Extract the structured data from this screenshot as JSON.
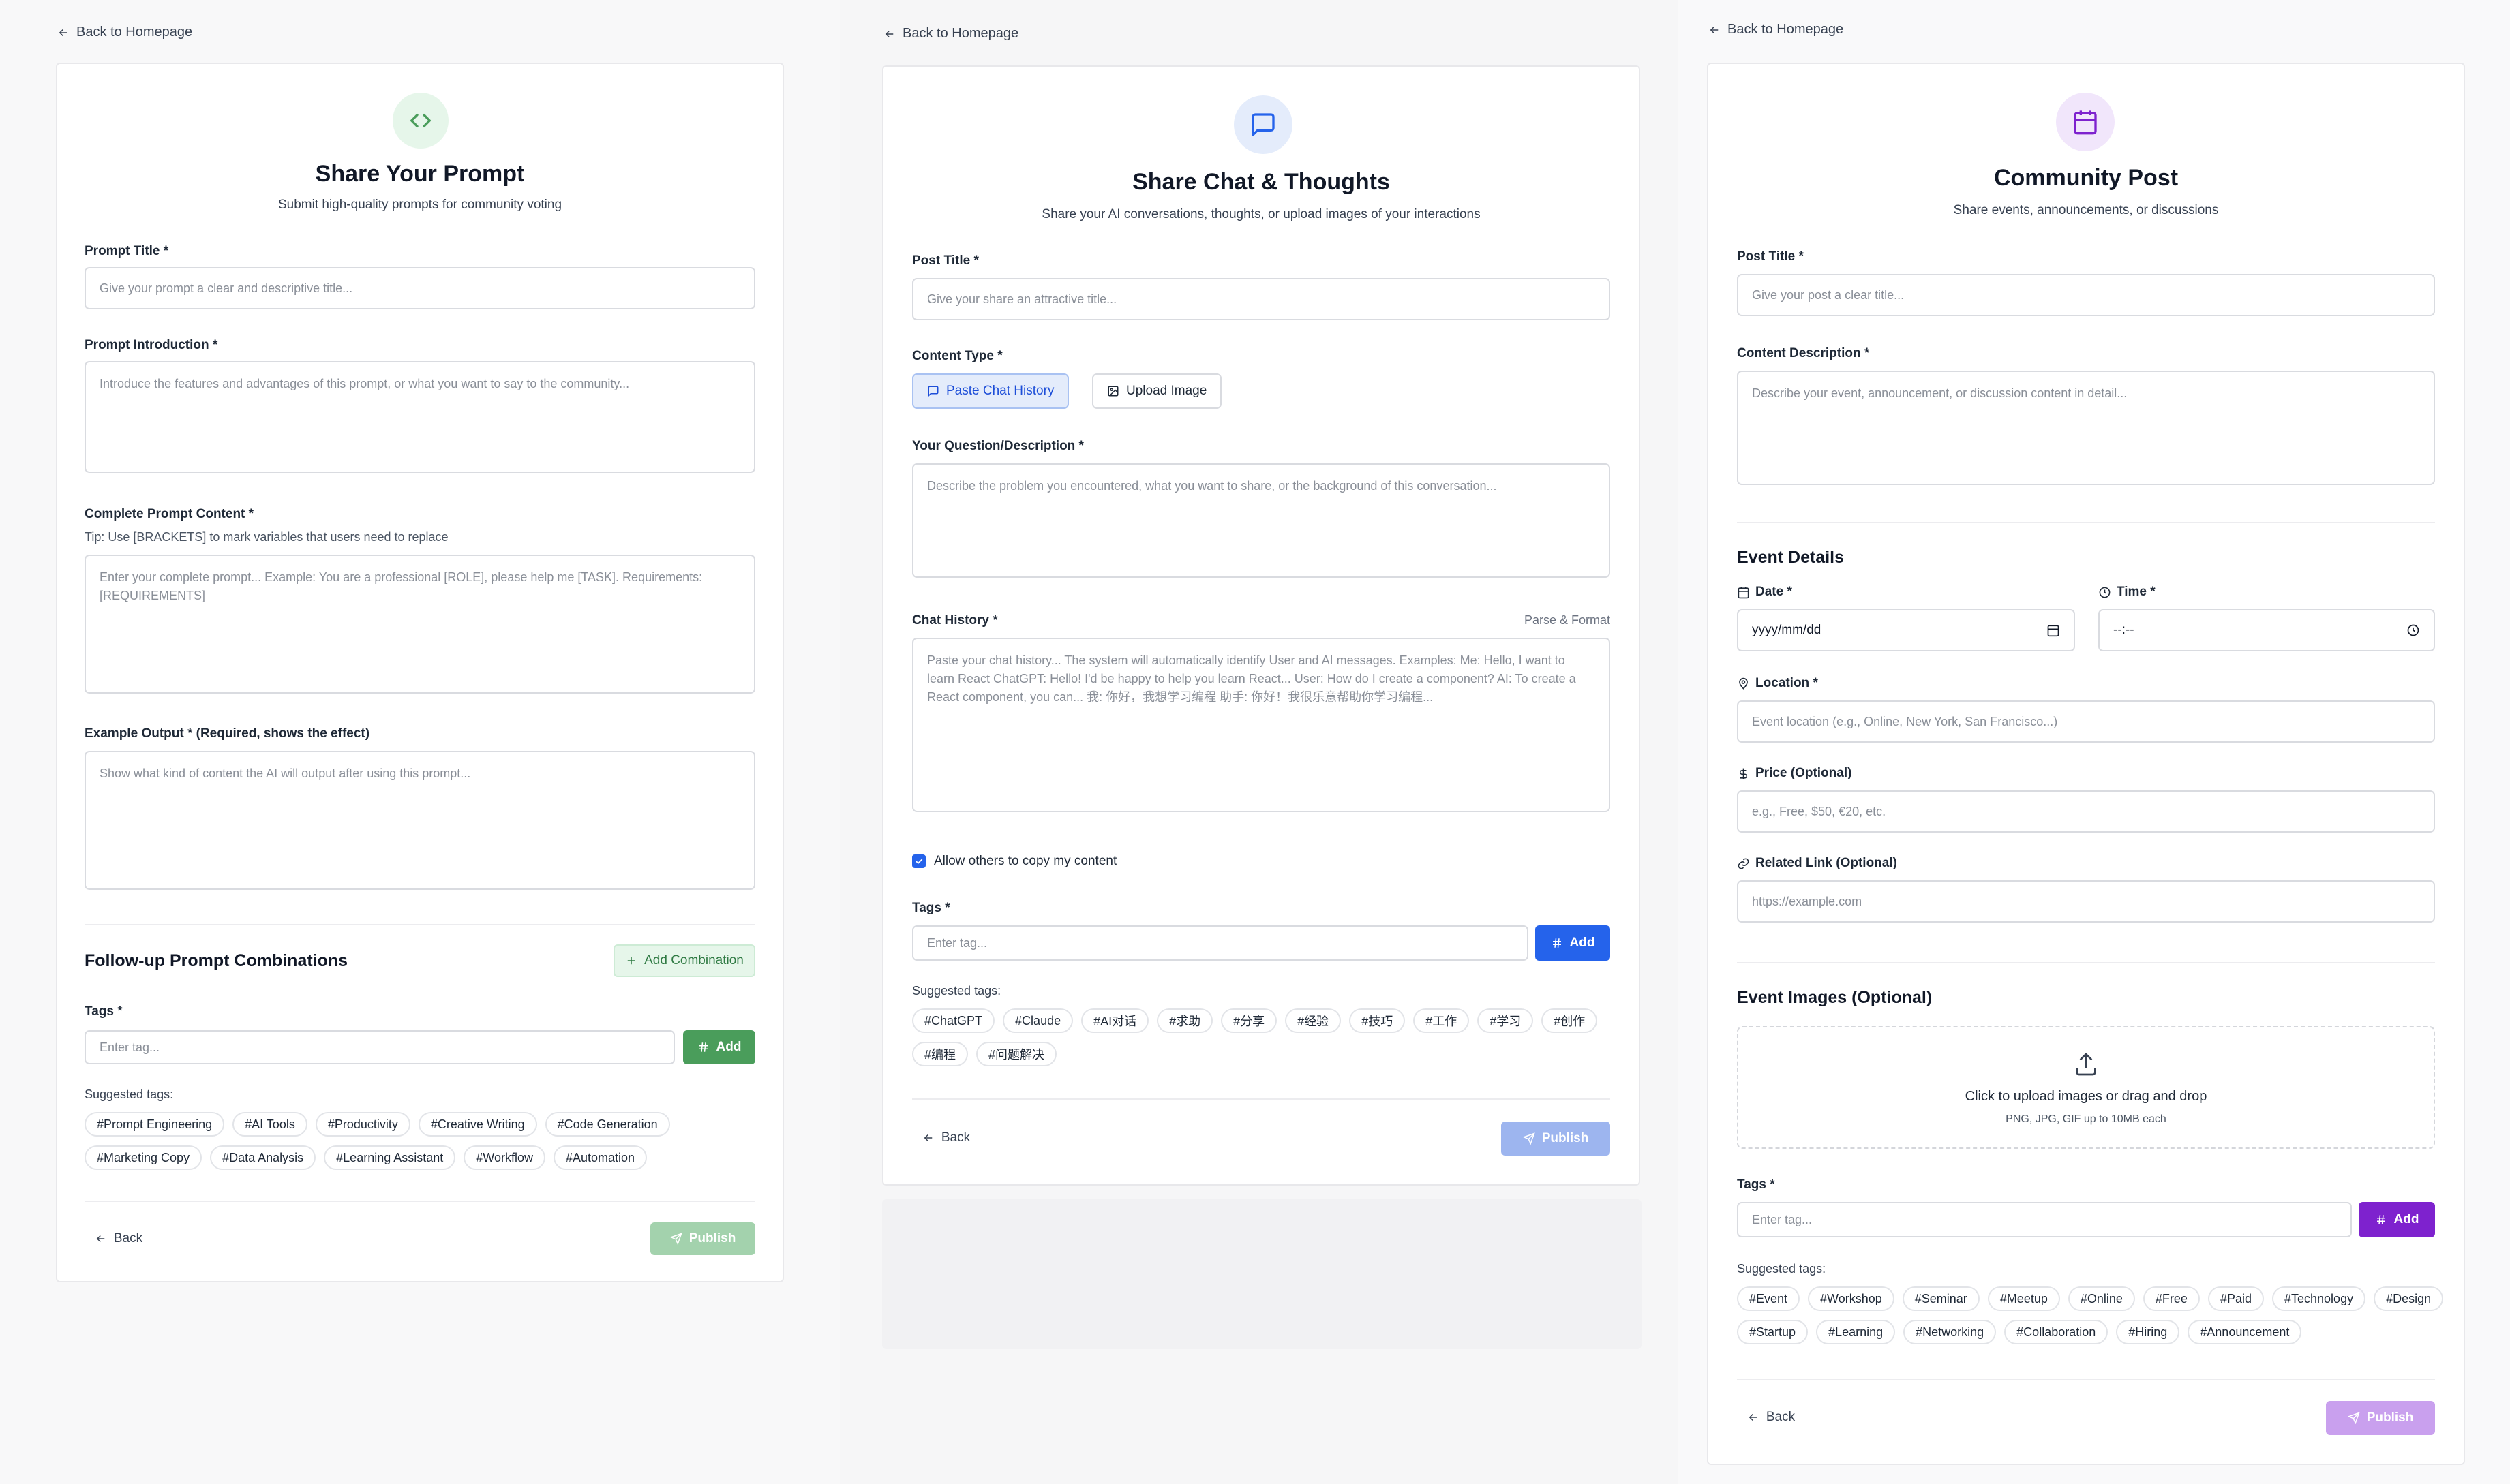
{
  "common": {
    "back_to_home": "Back to Homepage",
    "back": "Back",
    "publish": "Publish",
    "add": "Add",
    "tags_label": "Tags *",
    "tag_placeholder": "Enter tag...",
    "suggested_label": "Suggested tags:"
  },
  "prompt_form": {
    "title": "Share Your Prompt",
    "subtitle": "Submit high-quality prompts for community voting",
    "prompt_title_label": "Prompt Title *",
    "prompt_title_placeholder": "Give your prompt a clear and descriptive title...",
    "intro_label": "Prompt Introduction *",
    "intro_placeholder": "Introduce the features and advantages of this prompt, or what you want to say to the community...",
    "content_label": "Complete Prompt Content *",
    "content_tip": "Tip: Use [BRACKETS] to mark variables that users need to replace",
    "content_placeholder": "Enter your complete prompt...  Example: You are a professional [ROLE], please help me [TASK]. Requirements: [REQUIREMENTS]",
    "output_label": "Example Output * (Required, shows the effect)",
    "output_placeholder": "Show what kind of content the AI will output after using this prompt...",
    "followup_title": "Follow-up Prompt Combinations",
    "add_combination": "Add Combination",
    "suggested_tags": [
      "#Prompt Engineering",
      "#AI Tools",
      "#Productivity",
      "#Creative Writing",
      "#Code Generation",
      "#Marketing Copy",
      "#Data Analysis",
      "#Learning Assistant",
      "#Workflow",
      "#Automation"
    ]
  },
  "chat_form": {
    "title": "Share Chat & Thoughts",
    "subtitle": "Share your AI conversations, thoughts, or upload images of your interactions",
    "post_title_label": "Post Title *",
    "post_title_placeholder": "Give your share an attractive title...",
    "content_type_label": "Content Type *",
    "paste_chat": "Paste Chat History",
    "upload_image": "Upload Image",
    "question_label": "Your Question/Description *",
    "question_placeholder": "Describe the problem you encountered, what you want to share, or the background of this conversation...",
    "history_label": "Chat History *",
    "parse_format": "Parse & Format",
    "history_placeholder": "Paste your chat history... The system will automatically identify User and AI messages. Examples:  Me: Hello, I want to learn React ChatGPT: Hello! I'd be happy to help you learn React...  User: How do I create a component? AI: To create a React component, you can...  我: 你好，我想学习编程 助手: 你好！我很乐意帮助你学习编程...",
    "allow_copy": "Allow others to copy my content",
    "suggested_tags": [
      "#ChatGPT",
      "#Claude",
      "#AI对话",
      "#求助",
      "#分享",
      "#经验",
      "#技巧",
      "#工作",
      "#学习",
      "#创作",
      "#编程",
      "#问题解决"
    ]
  },
  "community_form": {
    "title": "Community Post",
    "subtitle": "Share events, announcements, or discussions",
    "post_title_label": "Post Title *",
    "post_title_placeholder": "Give your post a clear title...",
    "desc_label": "Content Description *",
    "desc_placeholder": "Describe your event, announcement, or discussion content in detail...",
    "event_details_title": "Event Details",
    "date_label": "Date *",
    "date_value": "yyyy/mm/dd",
    "time_label": "Time *",
    "time_value": "--:--",
    "location_label": "Location *",
    "location_placeholder": "Event location (e.g., Online, New York, San Francisco...)",
    "price_label": "Price (Optional)",
    "price_placeholder": "e.g., Free, $50, €20, etc.",
    "link_label": "Related Link (Optional)",
    "link_placeholder": "https://example.com",
    "images_title": "Event Images (Optional)",
    "upload_main": "Click to upload images or drag and drop",
    "upload_sub": "PNG, JPG, GIF up to 10MB each",
    "suggested_tags": [
      "#Event",
      "#Workshop",
      "#Seminar",
      "#Meetup",
      "#Online",
      "#Free",
      "#Paid",
      "#Technology",
      "#Design",
      "#Startup",
      "#Learning",
      "#Networking",
      "#Collaboration",
      "#Hiring",
      "#Announcement"
    ]
  },
  "colors": {
    "green": "#4a9d5b",
    "green_light": "#e6f6ea",
    "blue": "#2563eb",
    "blue_light": "#e4ecfb",
    "purple": "#7e22ce",
    "purple_light": "#f1e6fb"
  }
}
